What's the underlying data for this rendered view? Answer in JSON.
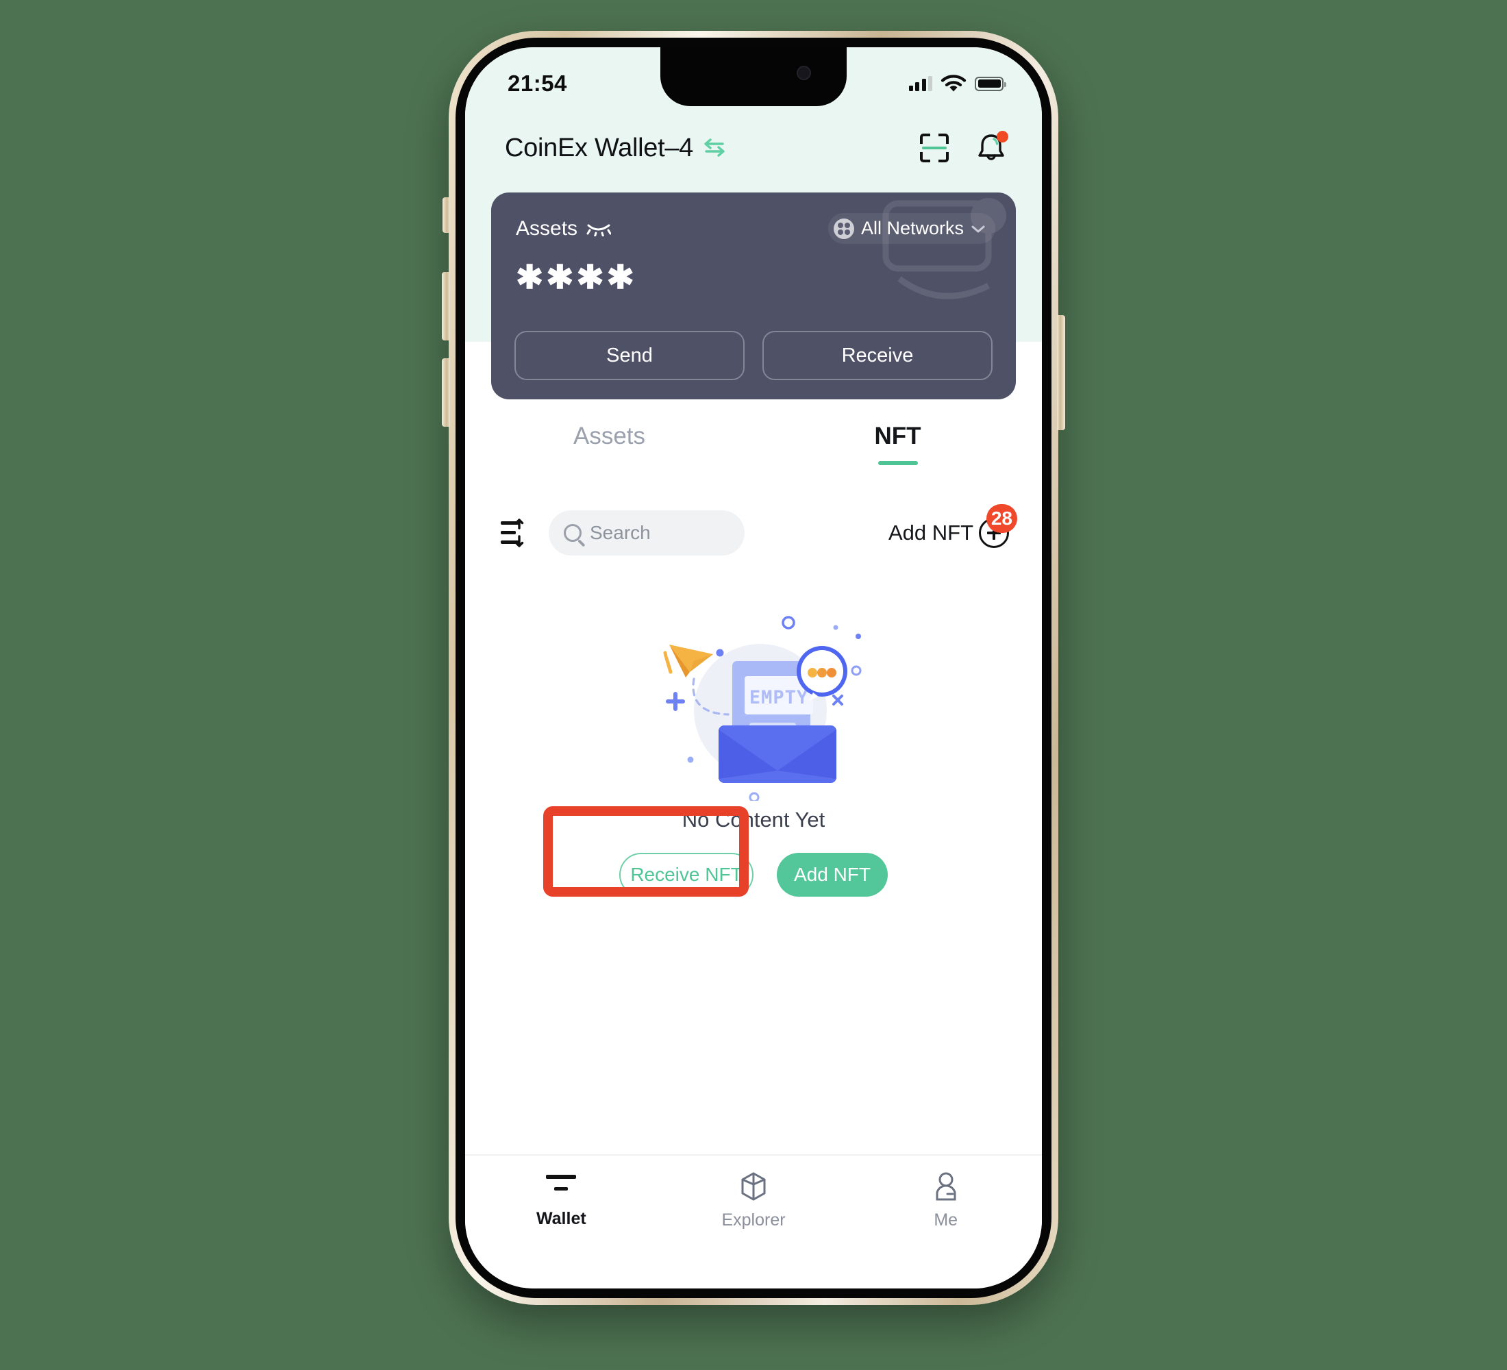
{
  "status_bar": {
    "time": "21:54",
    "signal_icon": "cellular-signal-icon",
    "wifi_icon": "wifi-icon",
    "battery_icon": "battery-full-icon"
  },
  "header": {
    "wallet_name": "CoinEx Wallet–4",
    "switch_icon": "switch-wallet-icon",
    "scan_icon": "scan-qr-icon",
    "notification_icon": "bell-icon",
    "notification_dot": true
  },
  "assets_card": {
    "label": "Assets",
    "eye_icon": "eye-hidden-icon",
    "network_selector": {
      "icon": "all-networks-icon",
      "label": "All Networks",
      "chevron": "chevron-down-icon"
    },
    "balance": "✱✱✱✱",
    "send_label": "Send",
    "receive_label": "Receive"
  },
  "tabs": [
    {
      "label": "Assets",
      "active": false
    },
    {
      "label": "NFT",
      "active": true
    }
  ],
  "toolbar": {
    "sort_icon": "sort-icon",
    "search_placeholder": "Search",
    "search_value": "",
    "search_icon": "search-icon",
    "add_nft_label": "Add NFT",
    "plus_icon": "plus-circle-icon",
    "badge_count": "28"
  },
  "empty_state": {
    "illustration": "empty-mailbox-illustration",
    "illustration_text": "EMPTY",
    "message": "No Content Yet",
    "receive_nft_label": "Receive NFT",
    "add_nft_label": "Add NFT"
  },
  "bottom_nav": [
    {
      "label": "Wallet",
      "icon": "wallet-icon",
      "active": true
    },
    {
      "label": "Explorer",
      "icon": "cube-icon",
      "active": false
    },
    {
      "label": "Me",
      "icon": "person-icon",
      "active": false
    }
  ],
  "annotation": {
    "type": "highlight-rectangle",
    "color": "#e8412a",
    "targets": "receive-nft-button"
  },
  "colors": {
    "page_background": "#4d7251",
    "screen_top": "#e9f6f2",
    "card": "#4f5167",
    "accent_green": "#4fc595",
    "button_green": "#54c79a",
    "badge_red": "#f0482a",
    "annotation_red": "#e8412a"
  }
}
